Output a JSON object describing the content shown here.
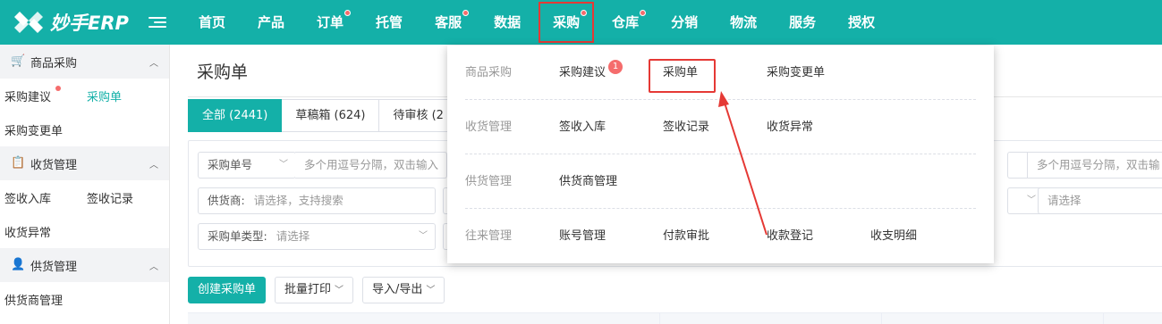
{
  "app": {
    "logo_text": "妙手ERP"
  },
  "topnav": {
    "items": [
      {
        "label": "首页",
        "dot": false
      },
      {
        "label": "产品",
        "dot": false
      },
      {
        "label": "订单",
        "dot": true
      },
      {
        "label": "托管",
        "dot": false
      },
      {
        "label": "客服",
        "dot": true
      },
      {
        "label": "数据",
        "dot": false
      },
      {
        "label": "采购",
        "dot": true,
        "active": true
      },
      {
        "label": "仓库",
        "dot": true
      },
      {
        "label": "分销",
        "dot": false
      },
      {
        "label": "物流",
        "dot": false
      },
      {
        "label": "服务",
        "dot": false
      },
      {
        "label": "授权",
        "dot": false
      }
    ]
  },
  "sidebar": {
    "groups": [
      {
        "title": "商品采购",
        "icon": "cart-icon",
        "items": [
          "采购建议",
          "采购单",
          "采购变更单"
        ]
      },
      {
        "title": "收货管理",
        "icon": "clipboard-check-icon",
        "items": [
          "签收入库",
          "签收记录",
          "收货异常"
        ]
      },
      {
        "title": "供货管理",
        "icon": "user-cog-icon",
        "items": [
          "供货商管理"
        ]
      }
    ]
  },
  "main": {
    "page_title": "采购单",
    "tabs": [
      "全部 (2441)",
      "草稿箱 (624)",
      "待审核 (2"
    ],
    "filters": {
      "order_no_select": "采购单号",
      "order_no_placeholder": "多个用逗号分隔，双击输入",
      "supplier_label": "供货商:",
      "supplier_placeholder": "请选择，支持搜索",
      "type_label": "采购单类型:",
      "type_placeholder": "请选择",
      "right_placeholder_1": "多个用逗号分隔，双击输",
      "right_placeholder_2": "请选择"
    },
    "buttons": {
      "create": "创建采购单",
      "batch_print": "批量打印",
      "import_export": "导入/导出"
    }
  },
  "mega_menu": {
    "rows": [
      {
        "category": "商品采购",
        "items": [
          "采购建议",
          "采购单",
          "采购变更单"
        ],
        "badge": "1"
      },
      {
        "category": "收货管理",
        "items": [
          "签收入库",
          "签收记录",
          "收货异常"
        ]
      },
      {
        "category": "供货管理",
        "items": [
          "供货商管理"
        ]
      },
      {
        "category": "往来管理",
        "items": [
          "账号管理",
          "付款审批",
          "收款登记",
          "收支明细"
        ]
      }
    ]
  },
  "colors": {
    "primary": "#14b0a8",
    "highlight": "#e53935",
    "badge": "#f56c6c"
  }
}
